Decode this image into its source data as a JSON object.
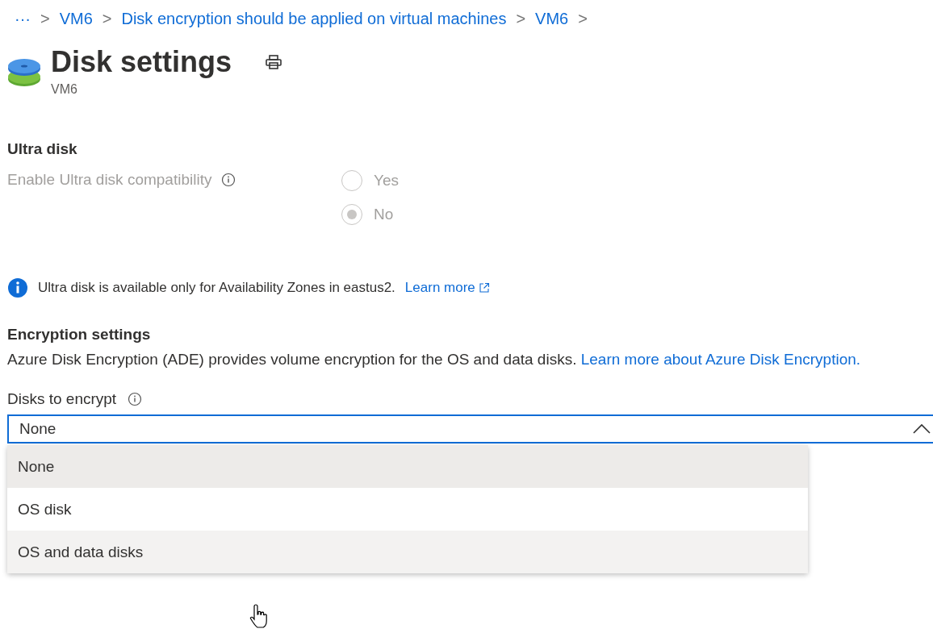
{
  "breadcrumb": {
    "ellipsis": "···",
    "items": [
      "VM6",
      "Disk encryption should be applied on virtual machines",
      "VM6"
    ],
    "separator": ">"
  },
  "header": {
    "title": "Disk settings",
    "subtitle": "VM6"
  },
  "ultra_disk": {
    "heading": "Ultra disk",
    "label": "Enable Ultra disk compatibility",
    "disabled": true,
    "options": [
      {
        "label": "Yes",
        "selected": false
      },
      {
        "label": "No",
        "selected": true
      }
    ]
  },
  "info_banner": {
    "text": "Ultra disk is available only for Availability Zones in eastus2.",
    "link": "Learn more"
  },
  "encryption": {
    "heading": "Encryption settings",
    "description": "Azure Disk Encryption (ADE) provides volume encryption for the OS and data disks.",
    "link": "Learn more about Azure Disk Encryption."
  },
  "disks_to_encrypt": {
    "label": "Disks to encrypt",
    "value": "None",
    "expanded": true,
    "options": [
      {
        "label": "None",
        "selected": true,
        "hovered": false
      },
      {
        "label": "OS disk",
        "selected": false,
        "hovered": false
      },
      {
        "label": "OS and data disks",
        "selected": false,
        "hovered": true
      }
    ]
  }
}
